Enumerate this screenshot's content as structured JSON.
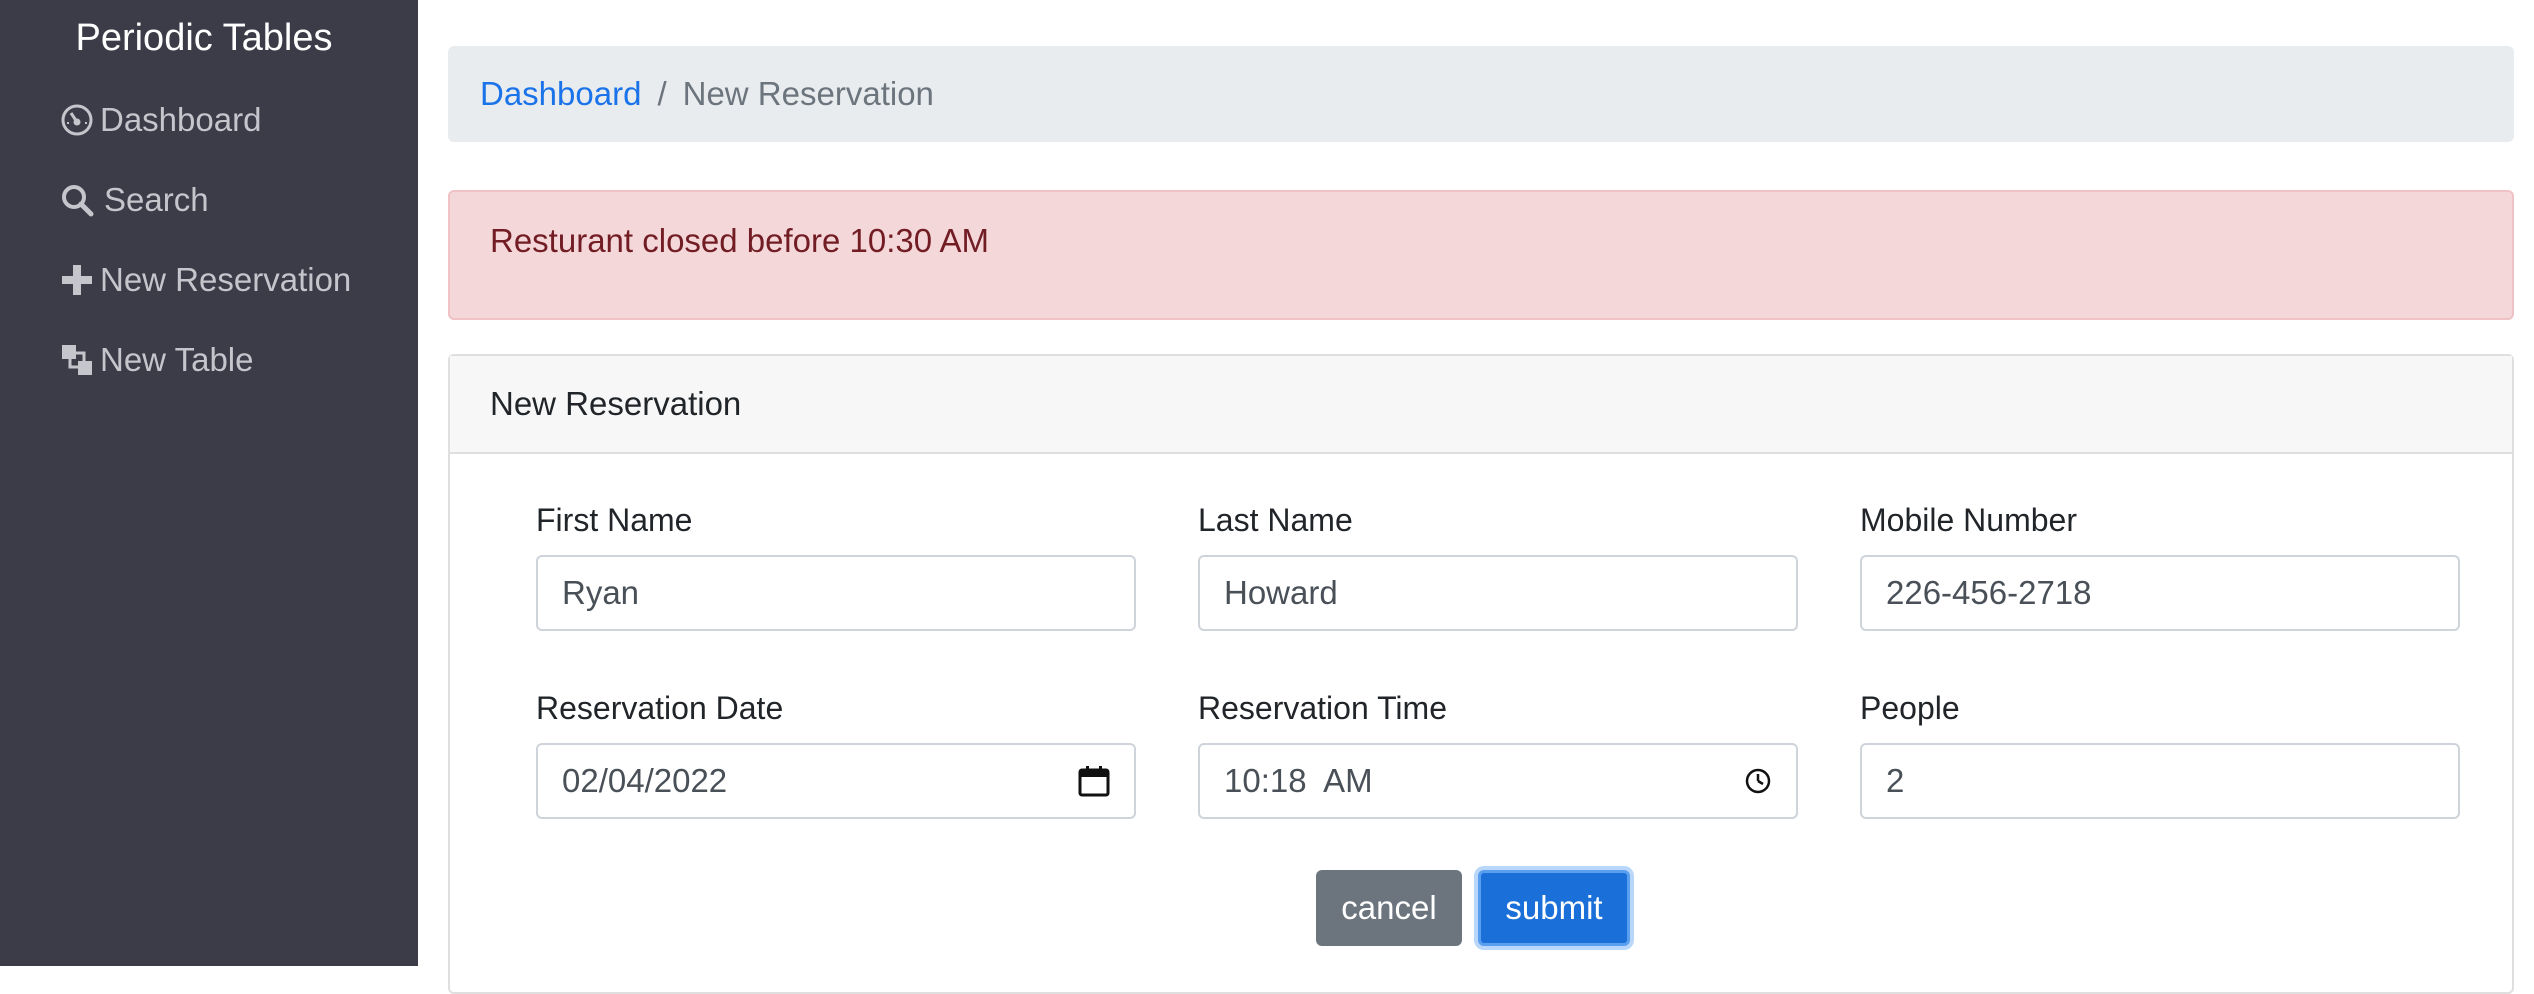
{
  "sidebar": {
    "brand": "Periodic Tables",
    "items": [
      {
        "label": "Dashboard",
        "icon": "dashboard-icon"
      },
      {
        "label": "Search",
        "icon": "search-icon"
      },
      {
        "label": "New Reservation",
        "icon": "plus-icon"
      },
      {
        "label": "New Table",
        "icon": "layers-icon"
      }
    ]
  },
  "breadcrumb": {
    "link": "Dashboard",
    "separator": "/",
    "active": "New Reservation"
  },
  "alert": {
    "message": "Resturant closed before 10:30 AM"
  },
  "card": {
    "title": "New Reservation",
    "fields": {
      "first_name": {
        "label": "First Name",
        "value": "Ryan"
      },
      "last_name": {
        "label": "Last Name",
        "value": "Howard"
      },
      "mobile_number": {
        "label": "Mobile Number",
        "value": "226-456-2718"
      },
      "reservation_date": {
        "label": "Reservation Date",
        "value": "02/04/2022"
      },
      "reservation_time": {
        "label": "Reservation Time",
        "value": "10:18  AM"
      },
      "people": {
        "label": "People",
        "value": "2"
      }
    },
    "buttons": {
      "cancel": "cancel",
      "submit": "submit"
    }
  },
  "colors": {
    "sidebar_bg": "#3b3c48",
    "link_blue": "#1a73e8",
    "alert_bg": "#f4d7d9",
    "alert_text": "#721c24",
    "submit_bg": "#1a6fd8",
    "cancel_bg": "#6c757d"
  }
}
